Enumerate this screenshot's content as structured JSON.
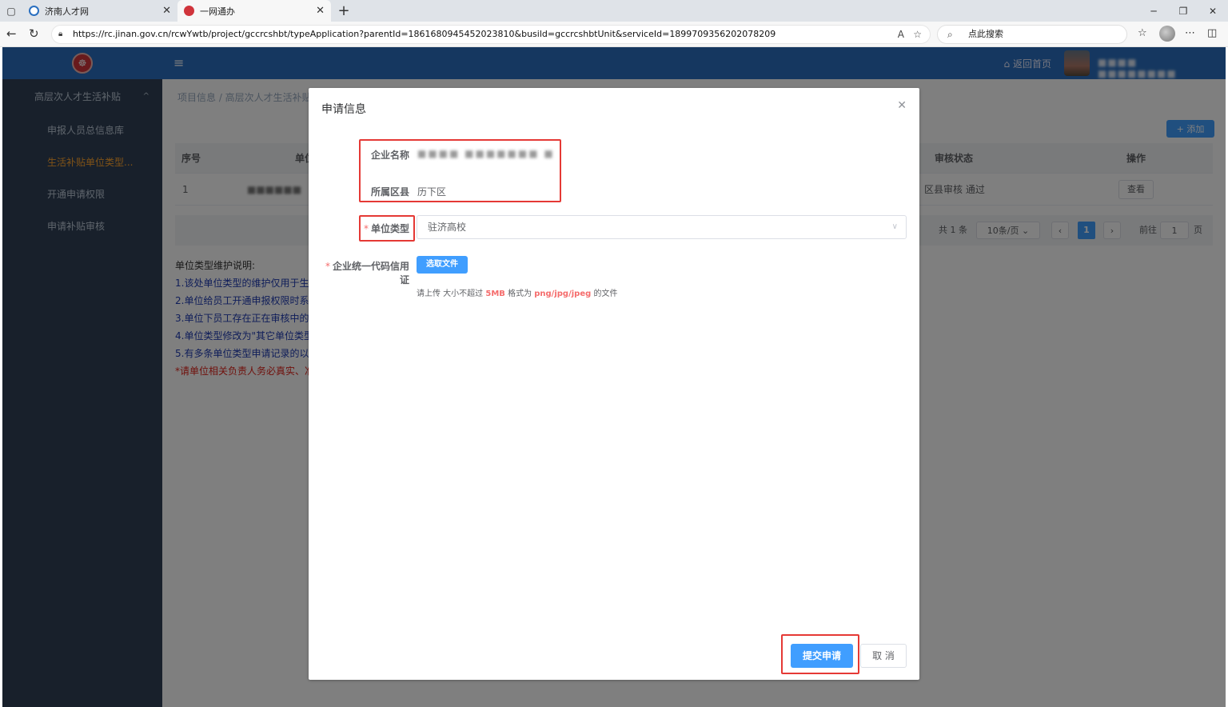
{
  "browser": {
    "tabs": [
      {
        "title": "济南人才网"
      },
      {
        "title": "一网通办"
      }
    ],
    "url": "https://rc.jinan.gov.cn/rcwYwtb/project/gccrcshbt/typeApplication?parentId=1861680945452023810&busild=gccrcshbtUnit&serviceId=1899709356202078209",
    "search_placeholder": "点此搜索"
  },
  "header": {
    "home_link": "返回首页",
    "user_name": "■■■■ ■■■■■■■■"
  },
  "sidebar": {
    "items": [
      {
        "label": "高层次人才生活补贴"
      },
      {
        "label": "申报人员总信息库"
      },
      {
        "label": "生活补贴单位类型..."
      },
      {
        "label": "开通申请权限"
      },
      {
        "label": "申请补贴审核"
      }
    ]
  },
  "breadcrumb": "项目信息 / 高层次人才生活补贴",
  "add_button": "+ 添加",
  "table": {
    "headers": [
      "序号",
      "单位",
      "审核状态",
      "操作"
    ],
    "rows": [
      {
        "index": "1",
        "unit": "■■■■■■",
        "status": "区县审核 通过",
        "action": "查看"
      }
    ]
  },
  "pagination": {
    "total": "共 1 条",
    "page_size": "10条/页",
    "current": "1",
    "goto_label": "前往",
    "goto_value": "1",
    "page_unit": "页"
  },
  "notes": {
    "title": "单位类型维护说明:",
    "lines": [
      "1.该处单位类型的维护仅用于生",
      "2.单位给员工开通申报权限时系",
      "3.单位下员工存在正在审核中的",
      "4.单位类型修改为\"其它单位类型",
      "5.有多条单位类型申请记录的以"
    ],
    "warning": "*请单位相关负责人务必真实、准"
  },
  "dialog": {
    "title": "申请信息",
    "company_name_label": "企业名称",
    "company_name_value": "■■■■ ■■■■■■■ ■",
    "district_label": "所属区县",
    "district_value": "历下区",
    "unit_type_label": "单位类型",
    "unit_type_value": "驻济高校",
    "license_label": "企业统一代码信用证",
    "upload_button": "选取文件",
    "upload_tip_prefix": "请上传 大小不超过 ",
    "upload_tip_size": "5MB",
    "upload_tip_mid": " 格式为 ",
    "upload_tip_formats": "png/jpg/jpeg",
    "upload_tip_suffix": " 的文件",
    "submit_button": "提交申请",
    "cancel_button": "取 消"
  },
  "colors": {
    "primary": "#409eff",
    "header_blue": "#2a6fc0",
    "sidebar_bg": "#304156",
    "sidebar_active": "#ffa52f",
    "highlight_red": "#e53935"
  }
}
